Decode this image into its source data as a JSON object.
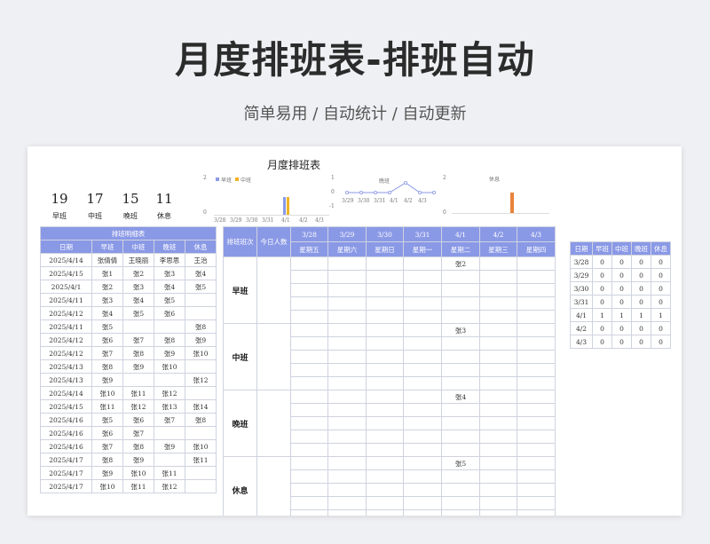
{
  "page": {
    "title": "月度排班表-排班自动",
    "subtitle": "简单易用 / 自动统计 / 自动更新"
  },
  "sheet": {
    "title": "月度排班表",
    "stats": [
      {
        "num": "19",
        "label": "早班"
      },
      {
        "num": "17",
        "label": "中班"
      },
      {
        "num": "15",
        "label": "晚班"
      },
      {
        "num": "11",
        "label": "休息"
      }
    ],
    "charts": {
      "bar": {
        "ymax": "2",
        "ymin": "0",
        "legend": [
          "早班",
          "中班"
        ],
        "colors": [
          "#8a99e6",
          "#f0b323"
        ],
        "x": [
          "3/28",
          "3/29",
          "3/30",
          "3/31",
          "4/1",
          "4/2",
          "4/3"
        ]
      },
      "line": {
        "title": "晚班",
        "ymax": "1",
        "ymin": "0",
        "ylow": "-1",
        "x": [
          "3/29",
          "3/30",
          "3/31",
          "4/1",
          "4/2",
          "4/3"
        ]
      },
      "rest": {
        "title": "休息",
        "ymax": "2",
        "ymin": "0",
        "color": "#e8833a"
      }
    },
    "detail": {
      "caption": "排班明细表",
      "headers": [
        "日期",
        "早班",
        "中班",
        "晚班",
        "休息"
      ],
      "rows": [
        [
          "2025/4/14",
          "张倩倩",
          "王晓丽",
          "李思思",
          "王治"
        ],
        [
          "2025/4/15",
          "张1",
          "张2",
          "张3",
          "张4"
        ],
        [
          "2025/4/1",
          "张2",
          "张3",
          "张4",
          "张5"
        ],
        [
          "2025/4/11",
          "张3",
          "张4",
          "张5",
          ""
        ],
        [
          "2025/4/12",
          "张4",
          "张5",
          "张6",
          ""
        ],
        [
          "2025/4/11",
          "张5",
          "",
          "",
          "张8"
        ],
        [
          "2025/4/12",
          "张6",
          "张7",
          "张8",
          "张9"
        ],
        [
          "2025/4/12",
          "张7",
          "张8",
          "张9",
          "张10"
        ],
        [
          "2025/4/13",
          "张8",
          "张9",
          "张10",
          ""
        ],
        [
          "2025/4/13",
          "张9",
          "",
          "",
          "张12"
        ],
        [
          "2025/4/14",
          "张10",
          "张11",
          "张12",
          ""
        ],
        [
          "2025/4/15",
          "张11",
          "张12",
          "张13",
          "张14"
        ],
        [
          "2025/4/16",
          "张5",
          "张6",
          "张7",
          "张8"
        ],
        [
          "2025/4/16",
          "张6",
          "张7",
          "",
          ""
        ],
        [
          "2025/4/16",
          "张7",
          "张8",
          "张9",
          "张10"
        ],
        [
          "2025/4/17",
          "张8",
          "张9",
          "",
          "张11"
        ],
        [
          "2025/4/17",
          "张9",
          "张10",
          "张11",
          ""
        ],
        [
          "2025/4/17",
          "张10",
          "张11",
          "张12",
          ""
        ]
      ]
    },
    "schedule": {
      "col1": "排班班次",
      "col2": "今日人数",
      "dates": [
        "3/28",
        "3/29",
        "3/30",
        "3/31",
        "4/1",
        "4/2",
        "4/3"
      ],
      "weekdays": [
        "星期五",
        "星期六",
        "星期日",
        "星期一",
        "星期二",
        "星期三",
        "星期四"
      ],
      "blocks": [
        {
          "name": "早班",
          "entry": "张2"
        },
        {
          "name": "中班",
          "entry": "张3"
        },
        {
          "name": "晚班",
          "entry": "张4"
        },
        {
          "name": "休息",
          "entry": "张5"
        }
      ]
    },
    "summary": {
      "headers": [
        "日期",
        "早班",
        "中班",
        "晚班",
        "休息"
      ],
      "rows": [
        [
          "3/28",
          "0",
          "0",
          "0",
          "0"
        ],
        [
          "3/29",
          "0",
          "0",
          "0",
          "0"
        ],
        [
          "3/30",
          "0",
          "0",
          "0",
          "0"
        ],
        [
          "3/31",
          "0",
          "0",
          "0",
          "0"
        ],
        [
          "4/1",
          "1",
          "1",
          "1",
          "1"
        ],
        [
          "4/2",
          "0",
          "0",
          "0",
          "0"
        ],
        [
          "4/3",
          "0",
          "0",
          "0",
          "0"
        ]
      ]
    }
  }
}
